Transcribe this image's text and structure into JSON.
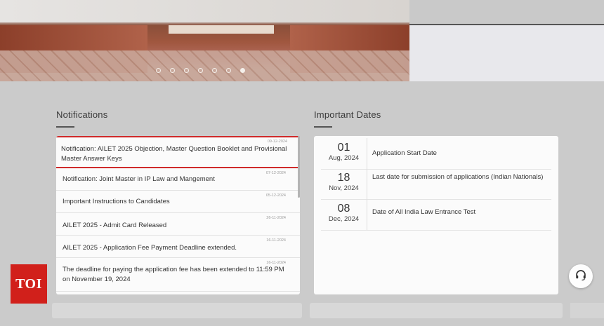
{
  "carousel": {
    "slides": 7,
    "active_index": 6
  },
  "notifications": {
    "title": "Notifications",
    "items": [
      {
        "date": "09-12-2024",
        "text": "Notification: AILET 2025 Objection, Master Question Booklet and Provisional Master Answer Keys"
      },
      {
        "date": "07-12-2024",
        "text": "Notification: Joint Master in IP Law and Mangement"
      },
      {
        "date": "05-12-2024",
        "text": "Important Instructions to Candidates"
      },
      {
        "date": "26-11-2024",
        "text": "AILET 2025 - Admit Card Released"
      },
      {
        "date": "16-11-2024",
        "text": "AILET 2025 - Application Fee Payment Deadline extended."
      },
      {
        "date": "16-11-2024",
        "text": "The deadline for paying the application fee has been extended to 11:59 PM on November 19, 2024"
      }
    ]
  },
  "important_dates": {
    "title": "Important Dates",
    "items": [
      {
        "day": "01",
        "month_year": "Aug, 2024",
        "desc": "Application Start Date"
      },
      {
        "day": "18",
        "month_year": "Nov, 2024",
        "desc": "Last date for submission of applications (Indian Nationals)"
      },
      {
        "day": "08",
        "month_year": "Dec, 2024",
        "desc": "Date of All India Law Entrance Test"
      }
    ]
  },
  "watermark": {
    "logo_text": "TOI",
    "color": "#d1201b"
  },
  "support": {
    "icon": "headset-icon"
  },
  "colors": {
    "highlight": "#cf2a2a"
  }
}
